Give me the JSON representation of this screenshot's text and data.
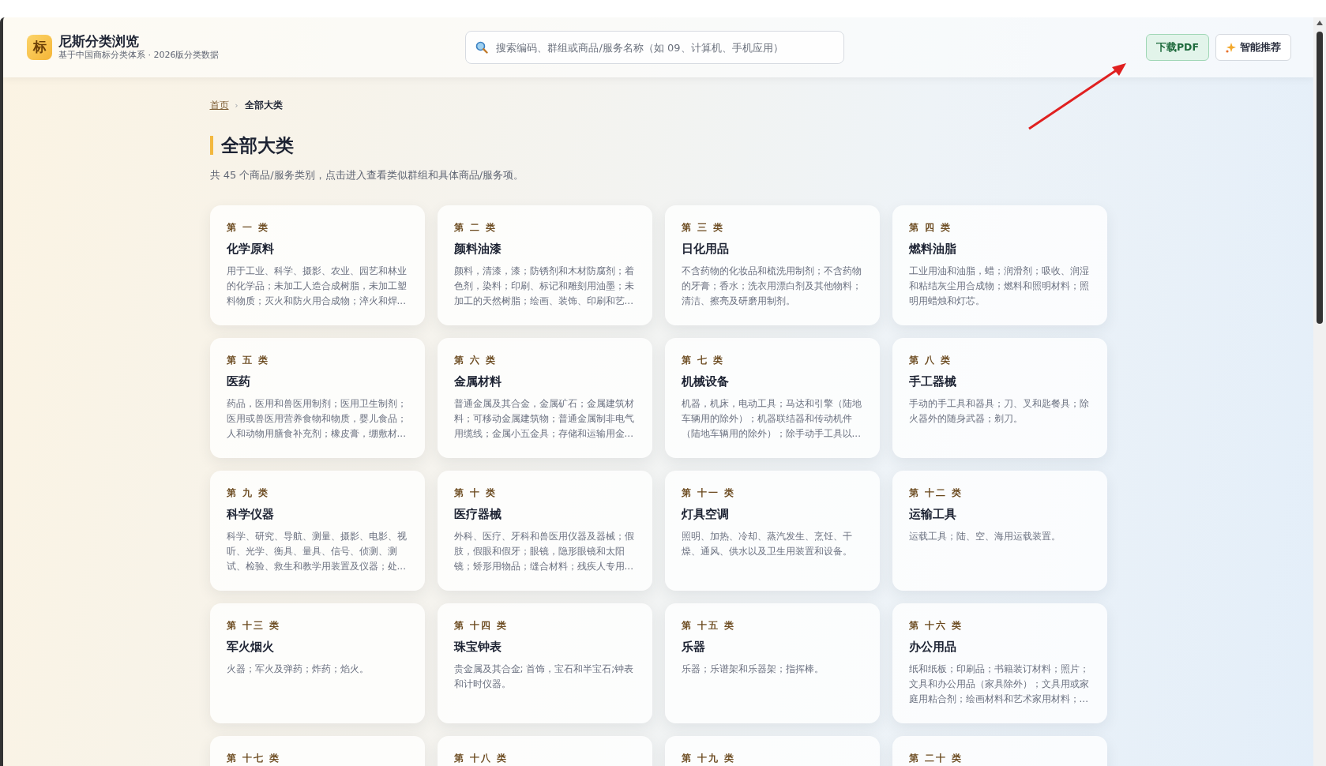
{
  "header": {
    "logo": "标",
    "title": "尼斯分类浏览",
    "subtitle": "基于中国商标分类体系 · 2026版分类数据"
  },
  "search": {
    "placeholder": "搜索编码、群组或商品/服务名称（如 09、计算机、手机应用）"
  },
  "buttons": [
    {
      "label": "下载PDF",
      "kind": "download"
    },
    {
      "label": "智能推荐",
      "kind": "recommend"
    }
  ],
  "breadcrumb": [
    {
      "label": "首页",
      "current": false
    },
    {
      "label": "全部大类",
      "current": true
    }
  ],
  "breadcrumb_separator": "›",
  "heading": "全部大类",
  "summary": "共 45 个商品/服务类别，点击进入查看类似群组和具体商品/服务项。",
  "classes": [
    {
      "label": "第 一 类",
      "name": "化学原料",
      "description": "用于工业、科学、摄影、农业、园艺和林业的化学品；未加工人造合成树脂，未加工塑料物质；灭火和防火用合成物；淬火和焊..."
    },
    {
      "label": "第 二 类",
      "name": "颜料油漆",
      "description": "颜料，清漆，漆；防锈剂和木材防腐剂；着色剂，染料；印刷、标记和雕刻用油墨；未加工的天然树脂；绘画、装饰、印刷和艺..."
    },
    {
      "label": "第 三 类",
      "name": "日化用品",
      "description": "不含药物的化妆品和梳洗用制剂；不含药物的牙膏；香水；洗衣用漂白剂及其他物料；清洁、擦亮及研磨用制剂。"
    },
    {
      "label": "第 四 类",
      "name": "燃料油脂",
      "description": "工业用油和油脂，蜡；润滑剂；吸收、润湿和粘结灰尘用合成物；燃料和照明材料；照明用蜡烛和灯芯。"
    },
    {
      "label": "第 五 类",
      "name": "医药",
      "description": "药品，医用和兽医用制剂；医用卫生制剂；医用或兽医用营养食物和物质，婴儿食品；人和动物用膳食补充剂；橡皮膏，绷敷材..."
    },
    {
      "label": "第 六 类",
      "name": "金属材料",
      "description": "普通金属及其合金，金属矿石；金属建筑材料；可移动金属建筑物；普通金属制非电气用缆线；金属小五金具；存储和运输用金..."
    },
    {
      "label": "第 七 类",
      "name": "机械设备",
      "description": "机器，机床，电动工具；马达和引擎（陆地车辆用的除外）；机器联结器和传动机件（陆地车辆用的除外）；除手动手工具以..."
    },
    {
      "label": "第 八 类",
      "name": "手工器械",
      "description": "手动的手工具和器具；刀、叉和匙餐具；除火器外的随身武器；剃刀。"
    },
    {
      "label": "第 九 类",
      "name": "科学仪器",
      "description": "科学、研究、导航、测量、摄影、电影、视听、光学、衡具、量具、信号、侦测、测试、检验、救生和教学用装置及仪器；处..."
    },
    {
      "label": "第 十 类",
      "name": "医疗器械",
      "description": "外科、医疗、牙科和兽医用仪器及器械；假肢，假眼和假牙；眼镜，隐形眼镜和太阳镜；矫形用物品；缝合材料；残疾人专用..."
    },
    {
      "label": "第 十一 类",
      "name": "灯具空调",
      "description": "照明、加热、冷却、蒸汽发生、烹饪、干燥、通风、供水以及卫生用装置和设备。"
    },
    {
      "label": "第 十二 类",
      "name": "运输工具",
      "description": "运载工具；陆、空、海用运载装置。"
    },
    {
      "label": "第 十三 类",
      "name": "军火烟火",
      "description": "火器；军火及弹药；炸药；焰火。"
    },
    {
      "label": "第 十四 类",
      "name": "珠宝钟表",
      "description": "贵金属及其合金; 首饰，宝石和半宝石;钟表和计时仪器。"
    },
    {
      "label": "第 十五 类",
      "name": "乐器",
      "description": "乐器；乐谱架和乐器架；指挥棒。"
    },
    {
      "label": "第 十六 类",
      "name": "办公用品",
      "description": "纸和纸板；印刷品；书籍装订材料；照片；文具和办公用品（家具除外）；文具用或家庭用粘合剂；绘画材料和艺术家用材料；..."
    },
    {
      "label": "第 十七 类"
    },
    {
      "label": "第 十八 类"
    },
    {
      "label": "第 十九 类"
    },
    {
      "label": "第 二十 类"
    }
  ]
}
